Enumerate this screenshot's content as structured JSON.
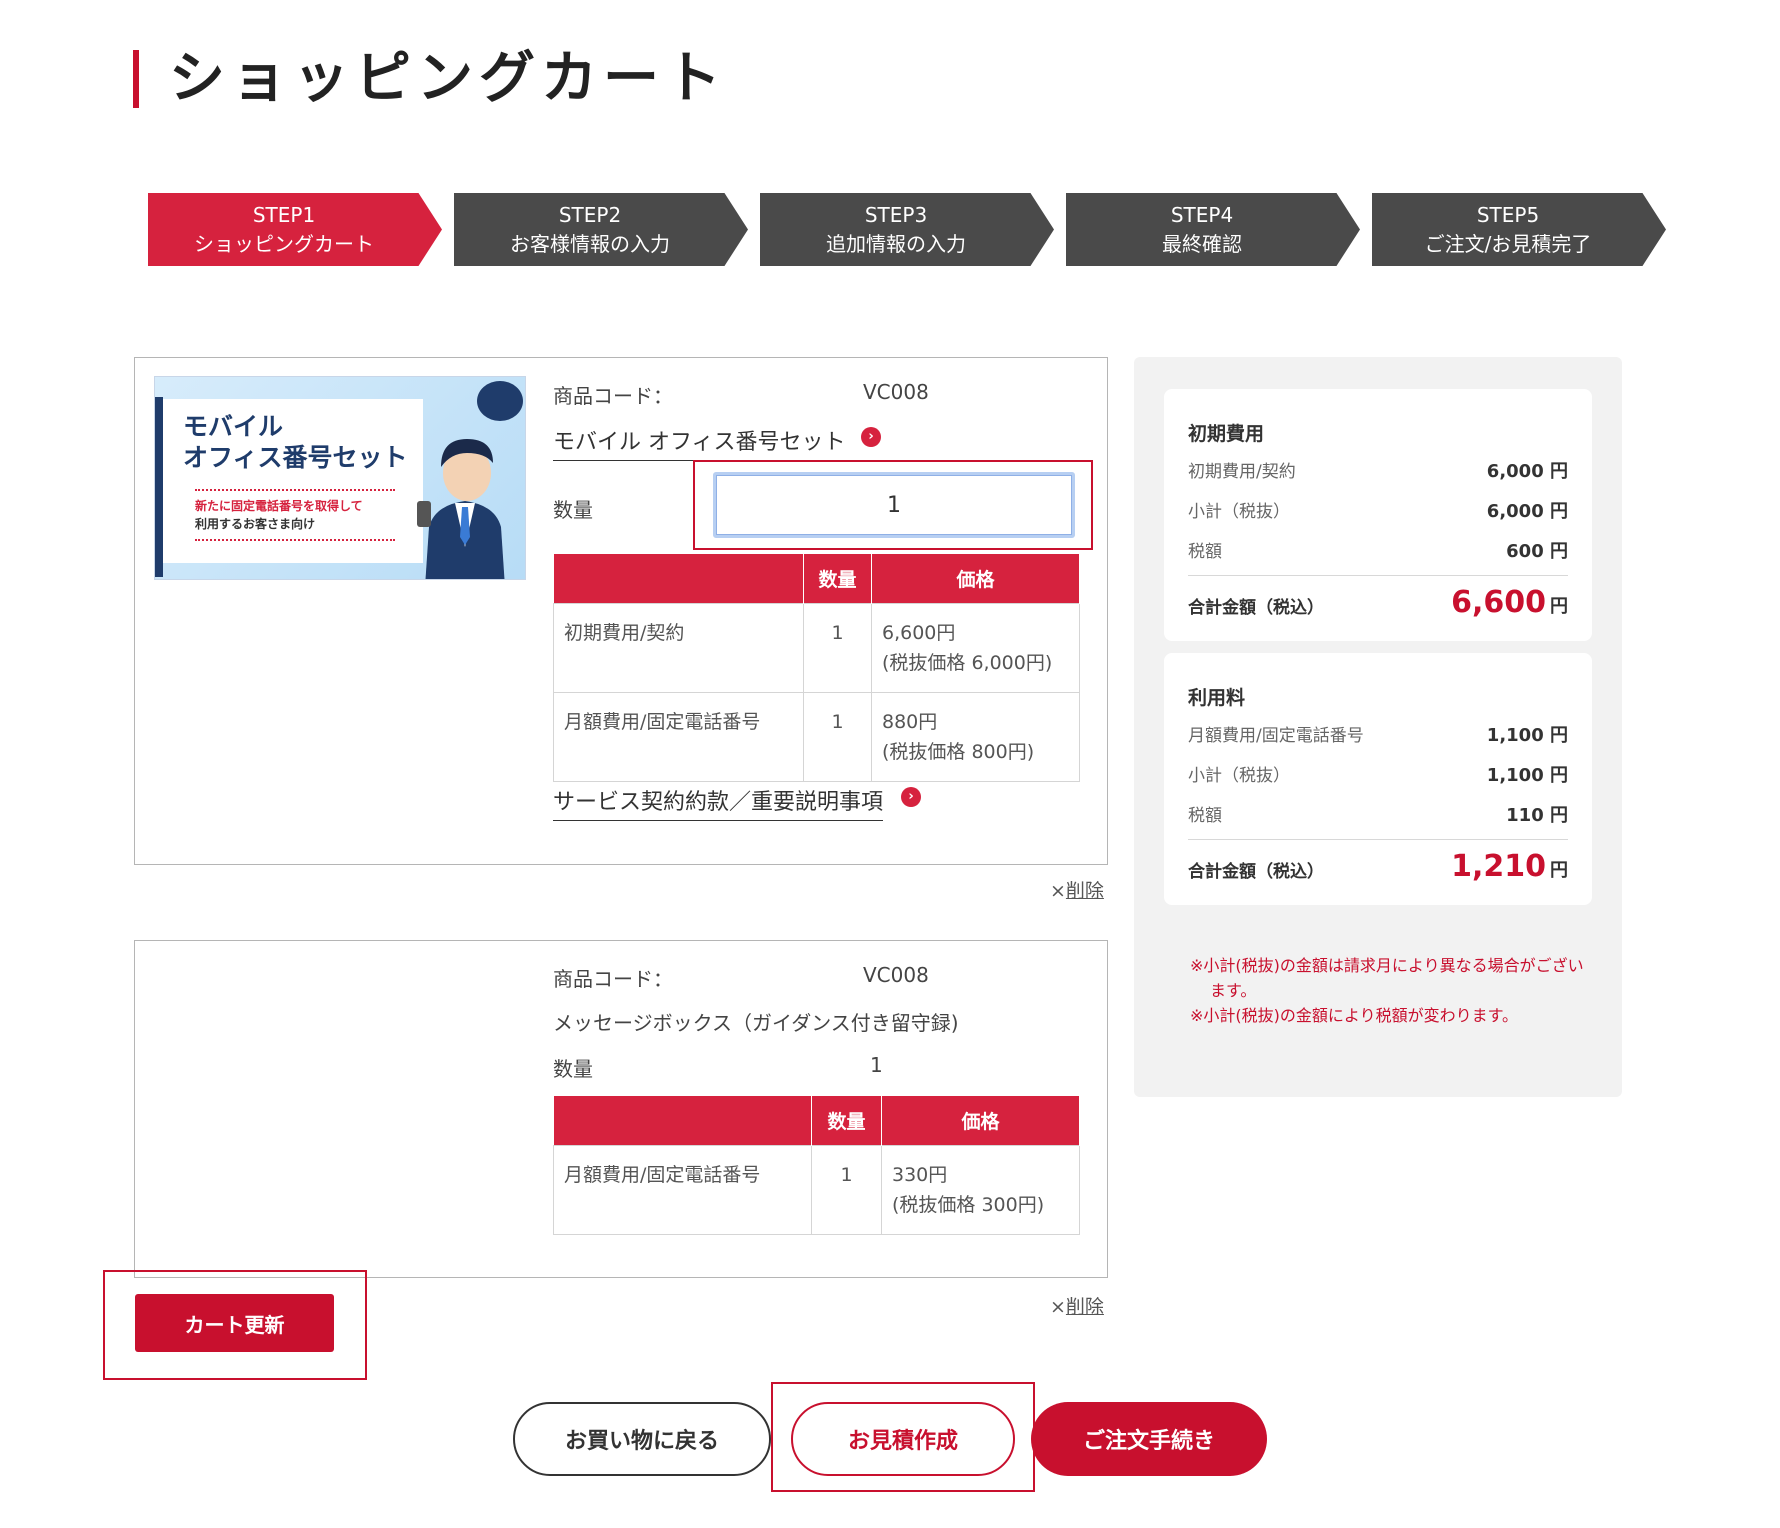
{
  "page_title": "ショッピングカート",
  "steps": [
    {
      "num": "STEP1",
      "label": "ショッピングカート",
      "active": true
    },
    {
      "num": "STEP2",
      "label": "お客様情報の入力",
      "active": false
    },
    {
      "num": "STEP3",
      "label": "追加情報の入力",
      "active": false
    },
    {
      "num": "STEP4",
      "label": "最終確認",
      "active": false
    },
    {
      "num": "STEP5",
      "label": "ご注文/お見積完了",
      "active": false
    }
  ],
  "items": [
    {
      "code_label": "商品コード：",
      "code": "VC008",
      "name": "モバイル オフィス番号セット",
      "qty_label": "数量",
      "qty": "1",
      "thumbnail": {
        "title_line1": "モバイル",
        "title_line2": "オフィス番号セット",
        "sub_line1": "新たに固定電話番号を取得して",
        "sub_line2": "利用するお客さま向け"
      },
      "table": {
        "headers": [
          "",
          "数量",
          "価格"
        ],
        "rows": [
          {
            "name": "初期費用/契約",
            "qty": "1",
            "price": "6,600円",
            "price_ex": "(税抜価格 6,000円)"
          },
          {
            "name": "月額費用/固定電話番号",
            "qty": "1",
            "price": "880円",
            "price_ex": "(税抜価格 800円)"
          }
        ]
      },
      "terms_link": "サービス契約約款／重要説明事項",
      "delete_mark": "×",
      "delete_label": "削除"
    },
    {
      "code_label": "商品コード：",
      "code": "VC008",
      "name": "メッセージボックス（ガイダンス付き留守録)",
      "qty_label": "数量",
      "qty": "1",
      "table": {
        "headers": [
          "",
          "数量",
          "価格"
        ],
        "rows": [
          {
            "name": "月額費用/固定電話番号",
            "qty": "1",
            "price": "330円",
            "price_ex": "(税抜価格 300円)"
          }
        ]
      },
      "delete_mark": "×",
      "delete_label": "削除"
    }
  ],
  "cart_update_label": "カート更新",
  "summary": {
    "initial": {
      "heading": "初期費用",
      "rows": [
        {
          "label": "初期費用/契約",
          "value": "6,000 円"
        },
        {
          "label": "小計（税抜）",
          "value": "6,000 円"
        },
        {
          "label": "税額",
          "value": "600 円"
        }
      ],
      "total_label": "合計金額（税込）",
      "total_value": "6,600",
      "total_unit": "円"
    },
    "usage": {
      "heading": "利用料",
      "rows": [
        {
          "label": "月額費用/固定電話番号",
          "value": "1,100 円"
        },
        {
          "label": "小計（税抜）",
          "value": "1,100 円"
        },
        {
          "label": "税額",
          "value": "110 円"
        }
      ],
      "total_label": "合計金額（税込）",
      "total_value": "1,210",
      "total_unit": "円"
    },
    "notes": [
      "※小計(税抜)の金額は請求月により異なる場合がございます。",
      "※小計(税抜)の金額により税額が変わります。"
    ]
  },
  "buttons": {
    "back": "お買い物に戻る",
    "estimate": "お見積作成",
    "order": "ご注文手続き"
  },
  "colors": {
    "brand_red": "#c8102e",
    "step_red": "#d6223e",
    "step_gray": "#4a4a4a"
  }
}
